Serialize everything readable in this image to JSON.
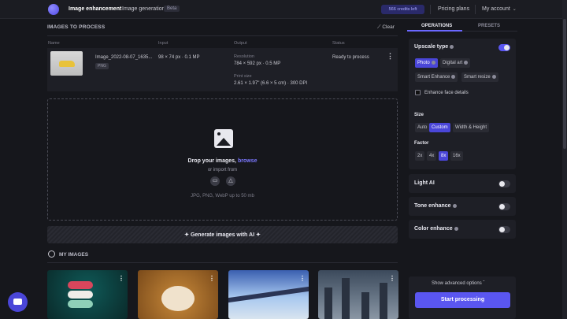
{
  "topbar": {
    "nav": [
      "Image enhancement",
      "Image generation"
    ],
    "beta": "Beta",
    "credits": "566 credits left",
    "pricing": "Pricing plans",
    "account": "My account"
  },
  "images": {
    "title": "IMAGES TO PROCESS",
    "clear": "Clear",
    "columns": [
      "Name",
      "Input",
      "Output",
      "Status"
    ],
    "row": {
      "name": "Image_2022-08-07_1635...",
      "format": "PNG",
      "input": "98 × 74 px · 0.1 MP",
      "resolution_label": "Resolution",
      "resolution": "784 × 592 px · 0.5 MP",
      "print_label": "Print size",
      "print": "2.61 × 1.97\" (6.6 × 5 cm) · 300 DPI",
      "status": "Ready to process"
    }
  },
  "dropzone": {
    "drop": "Drop your images,",
    "browse": "browse",
    "import": "or import from",
    "formats": "JPG, PNG, WebP up to 50 mb"
  },
  "gen_ai": "Generate images with AI",
  "my_images": "MY IMAGES",
  "panel": {
    "tabs": [
      "OPERATIONS",
      "PRESETS"
    ],
    "upscale_type": "Upscale type",
    "types": [
      "Photo",
      "Digital art",
      "Smart Enhance",
      "Smart resize"
    ],
    "enhance_face": "Enhance face details",
    "size_label": "Size",
    "sizes": [
      "Auto",
      "Custom",
      "Width & Height"
    ],
    "factor_label": "Factor",
    "factors": [
      "2x",
      "4x",
      "8x",
      "16x"
    ],
    "light_ai": "Light AI",
    "tone": "Tone enhance",
    "color": "Color enhance",
    "advanced": "Show advanced options",
    "start": "Start processing"
  }
}
